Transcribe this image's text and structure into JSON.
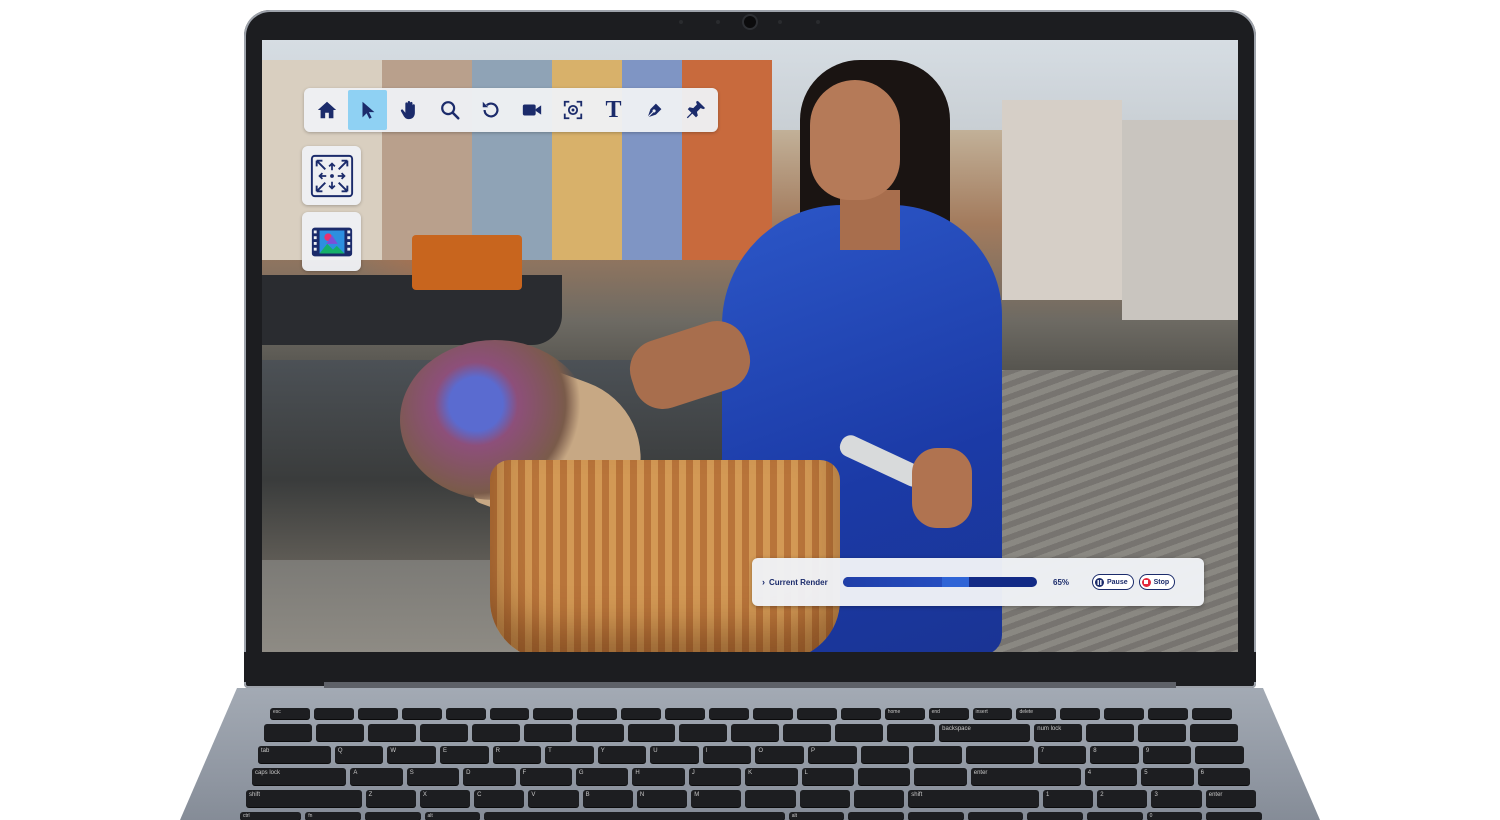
{
  "toolbar": {
    "tools": [
      {
        "name": "home",
        "icon": "home-icon",
        "active": false
      },
      {
        "name": "select",
        "icon": "cursor-arrow-icon",
        "active": true
      },
      {
        "name": "pan",
        "icon": "hand-icon",
        "active": false
      },
      {
        "name": "zoom",
        "icon": "magnifier-icon",
        "active": false
      },
      {
        "name": "rotate",
        "icon": "rotate-icon",
        "active": false
      },
      {
        "name": "record",
        "icon": "video-camera-icon",
        "active": false
      },
      {
        "name": "capture",
        "icon": "focus-capture-icon",
        "active": false
      },
      {
        "name": "text",
        "icon": "text-tool-icon",
        "active": false,
        "glyph": "T"
      },
      {
        "name": "pen",
        "icon": "pen-nib-icon",
        "active": false
      },
      {
        "name": "pin",
        "icon": "pushpin-icon",
        "active": false
      }
    ]
  },
  "side_buttons": [
    {
      "name": "fit-to-screen",
      "icon": "expand-arrows-icon"
    },
    {
      "name": "media",
      "icon": "filmstrip-image-icon"
    }
  ],
  "render": {
    "label": "Current Render",
    "progress": 0.65,
    "percent_text": "65%",
    "pause_label": "Pause",
    "stop_label": "Stop"
  },
  "colors": {
    "accent_navy": "#1b2b6b",
    "active_tool": "#8fd1f3",
    "stop_red": "#e5283c"
  },
  "keyboard": {
    "row0": [
      "esc",
      "",
      "",
      "",
      "",
      "",
      "",
      "",
      "",
      "",
      "",
      "",
      "",
      "",
      "home",
      "end",
      "insert",
      "delete",
      "",
      "",
      "",
      ""
    ],
    "row1": [
      "",
      "",
      "",
      "",
      "",
      "",
      "",
      "",
      "",
      "",
      "",
      "",
      "",
      "backspace",
      "num lock",
      "",
      "",
      ""
    ],
    "row2": [
      "tab",
      "Q",
      "W",
      "E",
      "R",
      "T",
      "Y",
      "U",
      "I",
      "O",
      "P",
      "",
      "",
      "",
      "7",
      "8",
      "9",
      ""
    ],
    "row3": [
      "caps lock",
      "A",
      "S",
      "D",
      "F",
      "G",
      "H",
      "J",
      "K",
      "L",
      "",
      "",
      "enter",
      "4",
      "5",
      "6"
    ],
    "row4": [
      "shift",
      "Z",
      "X",
      "C",
      "V",
      "B",
      "N",
      "M",
      "",
      "",
      "",
      "shift",
      "1",
      "2",
      "3",
      "enter"
    ],
    "row5": [
      "ctrl",
      "fn",
      "",
      "alt",
      "",
      "alt",
      "",
      "",
      "",
      "",
      "",
      "0",
      ""
    ]
  }
}
